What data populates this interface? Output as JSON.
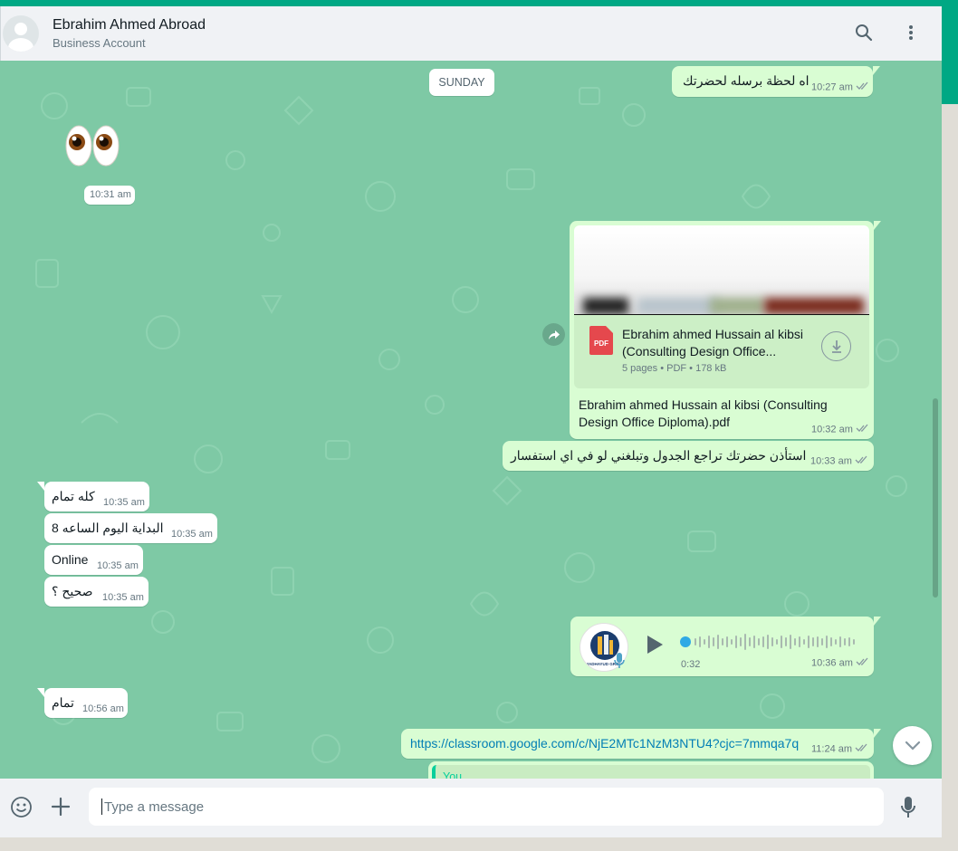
{
  "header": {
    "contact_name": "Ebrahim Ahmed Abroad",
    "subtitle": "Business Account",
    "icons": [
      "avatar-placeholder",
      "search-icon",
      "menu-dots-icon"
    ]
  },
  "date_badge": "SUNDAY",
  "messages": [
    {
      "dir": "out",
      "text": "اه لحظة برسله لحضرتك",
      "time": "10:27 am",
      "status": "read"
    },
    {
      "dir": "in",
      "type": "emoji",
      "text": "👀",
      "time": "10:31 am"
    },
    {
      "dir": "out",
      "type": "document",
      "file_name": "Ebrahim ahmed Hussain al kibsi (Consulting Design Office...",
      "meta": "5 pages • PDF • 178 kB",
      "caption": "Ebrahim ahmed Hussain al kibsi (Consulting Design Office Diploma).pdf",
      "time": "10:32 am",
      "status": "read"
    },
    {
      "dir": "out",
      "text": "استأذن حضرتك تراجع الجدول وتبلغني لو في اي استفسار",
      "time": "10:33 am",
      "status": "read"
    },
    {
      "dir": "in",
      "text": "كله تمام",
      "time": "10:35 am"
    },
    {
      "dir": "in",
      "text": "البداية اليوم الساعه 8",
      "time": "10:35 am"
    },
    {
      "dir": "in",
      "text": "Online",
      "time": "10:35 am"
    },
    {
      "dir": "in",
      "text": "صحيح ؟",
      "time": "10:35 am"
    },
    {
      "dir": "out",
      "type": "voice",
      "duration": "0:32",
      "time": "10:36 am",
      "status": "read",
      "avatar_text": "MADHAYUD GROUP"
    },
    {
      "dir": "in",
      "text": "تمام",
      "time": "10:56 am"
    },
    {
      "dir": "out",
      "type": "link",
      "text": "https://classroom.google.com/c/NjE2MTc1NzM3NTU4?cjc=7mmqa7q",
      "time": "11:24 am",
      "status": "read"
    },
    {
      "dir": "out",
      "type": "quote",
      "quote_author": "You"
    }
  ],
  "composer": {
    "placeholder": "Type a message",
    "icons": [
      "emoji-icon",
      "attach-plus-icon",
      "microphone-icon"
    ]
  },
  "colors": {
    "header_bg": "#f0f2f5",
    "chat_bg": "#7ec9a5",
    "outgoing_bubble": "#d9fdd3",
    "incoming_bubble": "#ffffff",
    "link": "#027eb5",
    "read_ticks": "#667781"
  }
}
